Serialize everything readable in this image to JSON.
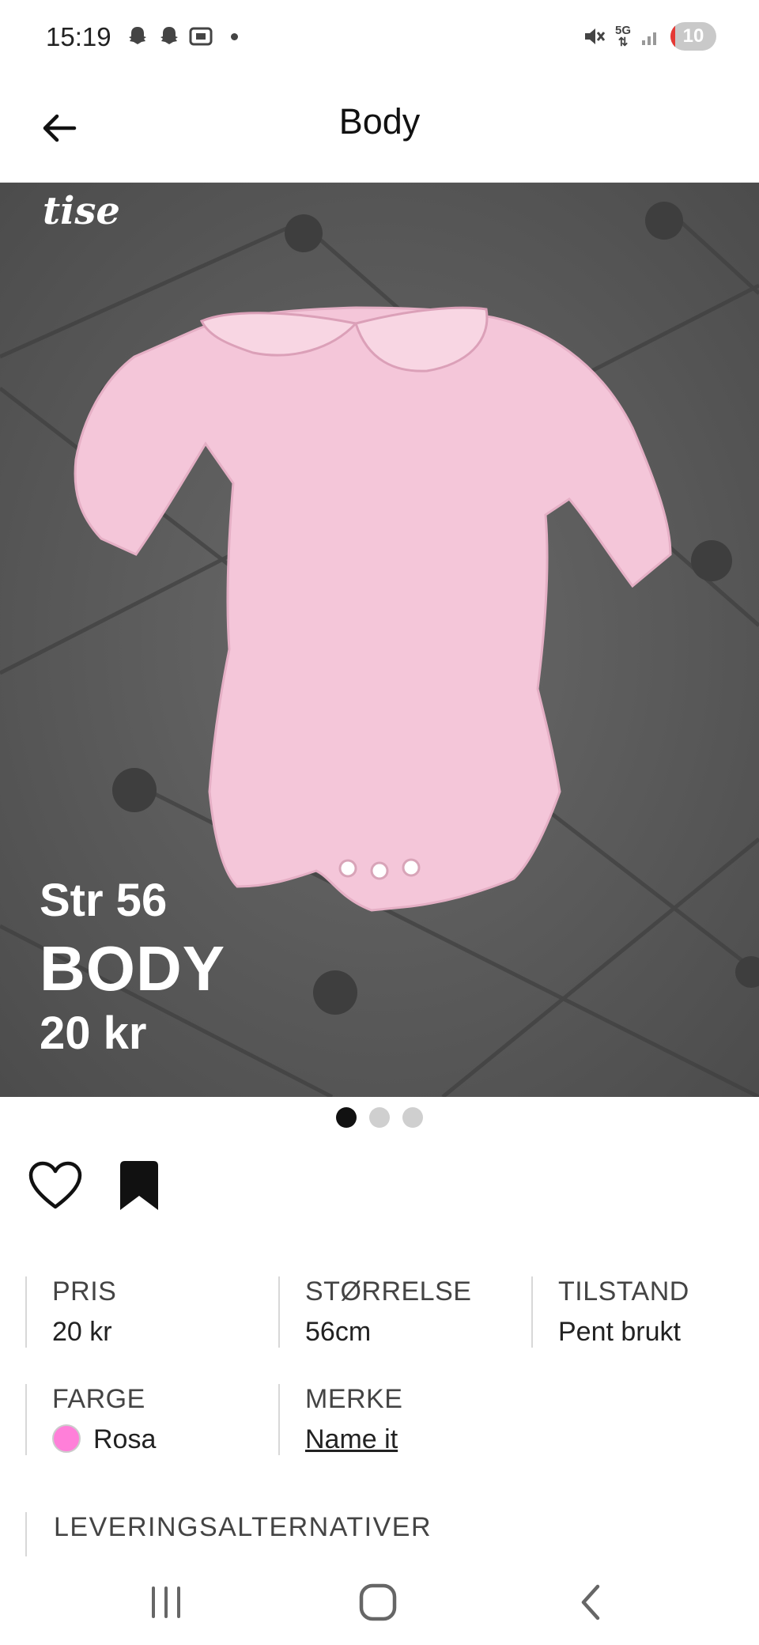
{
  "status_bar": {
    "time": "15:19",
    "network": "5G",
    "battery": "10"
  },
  "header": {
    "title": "Body"
  },
  "hero": {
    "watermark": "tise",
    "overlay_size": "Str 56",
    "overlay_name": "BODY",
    "overlay_price": "20 kr",
    "image_count": 3,
    "active_index": 0
  },
  "details": {
    "price": {
      "label": "PRIS",
      "value": "20 kr"
    },
    "size": {
      "label": "STØRRELSE",
      "value": "56cm"
    },
    "condition": {
      "label": "TILSTAND",
      "value": "Pent brukt"
    },
    "color": {
      "label": "FARGE",
      "value": "Rosa",
      "swatch": "#ff7fd9"
    },
    "brand": {
      "label": "MERKE",
      "value": "Name it"
    }
  },
  "delivery": {
    "label": "LEVERINGSALTERNATIVER"
  },
  "colors": {
    "photo_bg": "#5b5b5b",
    "garment": "#f4c6d9"
  }
}
